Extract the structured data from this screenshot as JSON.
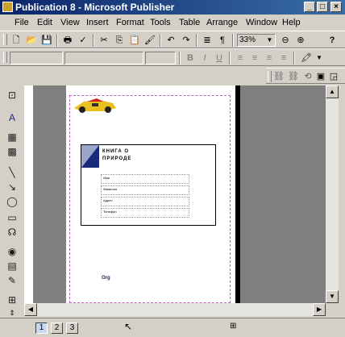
{
  "window": {
    "title": "Publication 8 - Microsoft Publisher"
  },
  "menu": [
    "File",
    "Edit",
    "View",
    "Insert",
    "Format",
    "Tools",
    "Table",
    "Arrange",
    "Window",
    "Help"
  ],
  "toolbar": {
    "zoom": "33%",
    "help_label": "?"
  },
  "document": {
    "heading_line1": "КНИГА О",
    "heading_line2": "ПРИРОДЕ",
    "form_fields": [
      "Имя",
      "Фамилия",
      "Адрес",
      "Телефон"
    ],
    "logo_text": "Org"
  },
  "statusbar": {
    "pages": [
      "1",
      "2",
      "3"
    ]
  },
  "colors": {
    "titlebar": "#0a246a",
    "chrome": "#d4d0c8",
    "workspace": "#808080"
  }
}
